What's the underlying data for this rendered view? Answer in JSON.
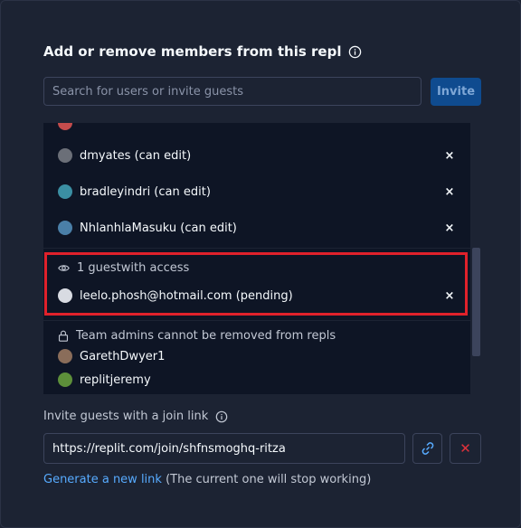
{
  "dialog": {
    "title": "Add or remove members from this repl"
  },
  "search": {
    "placeholder": "Search for users or invite guests",
    "value": ""
  },
  "invite_button": {
    "label": "Invite"
  },
  "members": [
    {
      "name": "dmyates (can edit)",
      "avatar_color": "#6b6f78",
      "remove": "×"
    },
    {
      "name": "bradleyindri (can edit)",
      "avatar_color": "#3b8fa3",
      "remove": "×"
    },
    {
      "name": "NhlanhlaMasuku (can edit)",
      "avatar_color": "#4a7fa8",
      "remove": "×"
    }
  ],
  "guests": {
    "label": "1 guestwith access",
    "icon": "eye-icon",
    "items": [
      {
        "name": "leelo.phosh@hotmail.com (pending)",
        "avatar_color": "#d8dbe2",
        "remove": "×"
      }
    ]
  },
  "admins": {
    "label": "Team admins cannot be removed from repls",
    "icon": "lock-icon",
    "items": [
      {
        "name": "GarethDwyer1",
        "avatar_color": "#8a6d5a"
      },
      {
        "name": "replitjeremy",
        "avatar_color": "#5d8f3a"
      }
    ]
  },
  "join_link": {
    "label": "Invite guests with a join link",
    "url": "https://replit.com/join/shfnsmoghq-ritza",
    "generate_label": "Generate a new link",
    "generate_note": " (The current one will stop working)",
    "revoke_symbol": "✕"
  },
  "colors": {
    "background": "#1c2333",
    "panel": "#0e1525",
    "accent": "#0f4b8f",
    "link": "#57abff",
    "highlight": "#e0212b",
    "danger": "#e0313b"
  }
}
